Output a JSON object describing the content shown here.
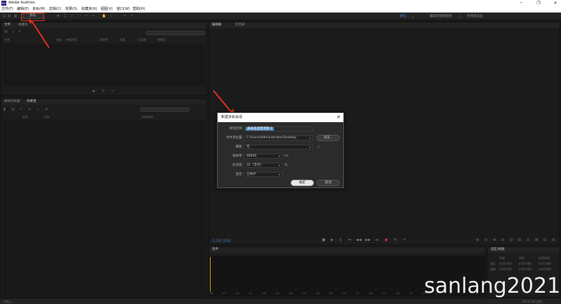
{
  "titlebar": {
    "logo_text": "Au",
    "title": "Adobe Audition",
    "minimize": "─",
    "restore": "❐",
    "close": "✕"
  },
  "menu": [
    "文件(F)",
    "编辑(E)",
    "多轨(M)",
    "剪辑(C)",
    "效果(S)",
    "收藏夹(R)",
    "视图(V)",
    "窗口(W)",
    "帮助(H)"
  ],
  "toolbar": {
    "mode_label": "多轨",
    "workspaces": [
      "默认",
      "编辑音频到视频",
      "无线电作品"
    ]
  },
  "files_panel": {
    "tabs": [
      "文件",
      "收藏夹"
    ],
    "columns": [
      "名称",
      "状态",
      "持续时间",
      "采样率",
      "声道",
      "位深度",
      "源格式"
    ]
  },
  "media_panel": {
    "tabs": [
      "媒体浏览器",
      "效果组"
    ],
    "columns": [
      "名称",
      "开始",
      "持续时间"
    ]
  },
  "editor_panel": {
    "tabs": [
      "编辑器",
      "混音器"
    ],
    "timecode": "0:00.000"
  },
  "dialog": {
    "title": "新建多轨会话",
    "close": "✕",
    "session_name_label": "会话名称:",
    "session_name_value": "未命名混音项目 1",
    "folder_label": "文件夹位置:",
    "folder_value": "C:\\Users\\Administrator\\Desktop",
    "browse_button": "浏览...",
    "template_label": "模板:",
    "template_value": "无",
    "sample_rate_label": "采样率:",
    "sample_rate_value": "48000",
    "sample_rate_unit": "Hz",
    "bit_depth_label": "位深度:",
    "bit_depth_value": "32（浮点）",
    "bit_depth_unit": "位",
    "mix_label": "混合:",
    "mix_value": "立体声",
    "ok_button": "确定",
    "cancel_button": "取消"
  },
  "levels_panel": {
    "tab": "电平",
    "ticks": [
      "dB",
      "-57",
      "-54",
      "-51",
      "-48",
      "-45",
      "-42",
      "-39",
      "-36",
      "-33",
      "-30",
      "-27",
      "-24",
      "-21",
      "-18",
      "-15",
      "-12",
      "-9",
      "-6",
      "-3",
      "0"
    ]
  },
  "selection_panel": {
    "tab": "选区/视图",
    "col_start": "开始",
    "col_end": "结束",
    "col_duration": "持续时间",
    "row_selection": "选区",
    "row_view": "视图",
    "zero": "0:00.000"
  },
  "statusbar": {
    "left": "已停止",
    "right": "20.72 GB 空闲"
  },
  "watermark": "sanlang2021",
  "colors": {
    "annotation": "#e03020",
    "accent": "#4a90e2",
    "selection": "#5a8fc8"
  }
}
